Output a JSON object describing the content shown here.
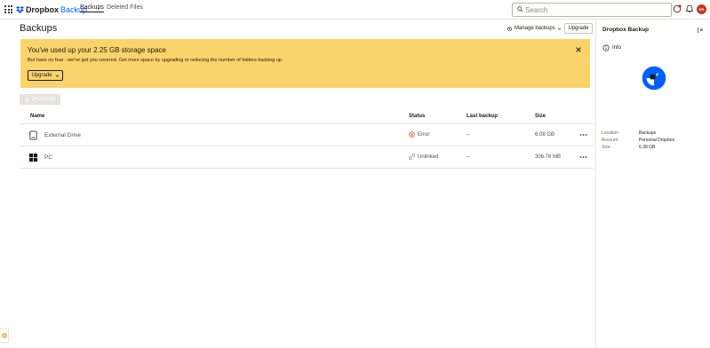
{
  "header": {
    "logo_brand": "Dropbox",
    "logo_product": "Backup",
    "nav": [
      {
        "label": "Backups"
      },
      {
        "label": "Deleted Files"
      }
    ],
    "search": {
      "placeholder": "Search",
      "value": ""
    },
    "avatar_initials": "DR"
  },
  "main": {
    "title": "Backups",
    "manage_label": "Manage backups",
    "upgrade_label": "Upgrade",
    "banner": {
      "title": "You've used up your 2.25 GB storage space",
      "body": "But have no fear - we've got you covered. Get more space by upgrading or reducing the number of folders backing up.",
      "button_label": "Upgrade"
    },
    "download_label": "Download",
    "table": {
      "columns": [
        "Name",
        "Status",
        "Last backup",
        "Size"
      ],
      "rows": [
        {
          "name": "External Drive",
          "status": "Error",
          "last_backup": "--",
          "size": "6.08 GB",
          "icon": "external-drive-icon"
        },
        {
          "name": "PC",
          "status": "Unlinked",
          "last_backup": "--",
          "size": "306.76 MB",
          "icon": "windows-icon"
        }
      ]
    }
  },
  "side_panel": {
    "title": "Dropbox Backup",
    "info_label": "Info",
    "meta": [
      {
        "key": "Location",
        "value": "Backups"
      },
      {
        "key": "Account",
        "value": "Personal Dropbox"
      },
      {
        "key": "Size",
        "value": "6.38 GB"
      }
    ]
  },
  "colors": {
    "accent": "#0061fe",
    "banner": "#fad46b",
    "error": "#c5361f"
  }
}
